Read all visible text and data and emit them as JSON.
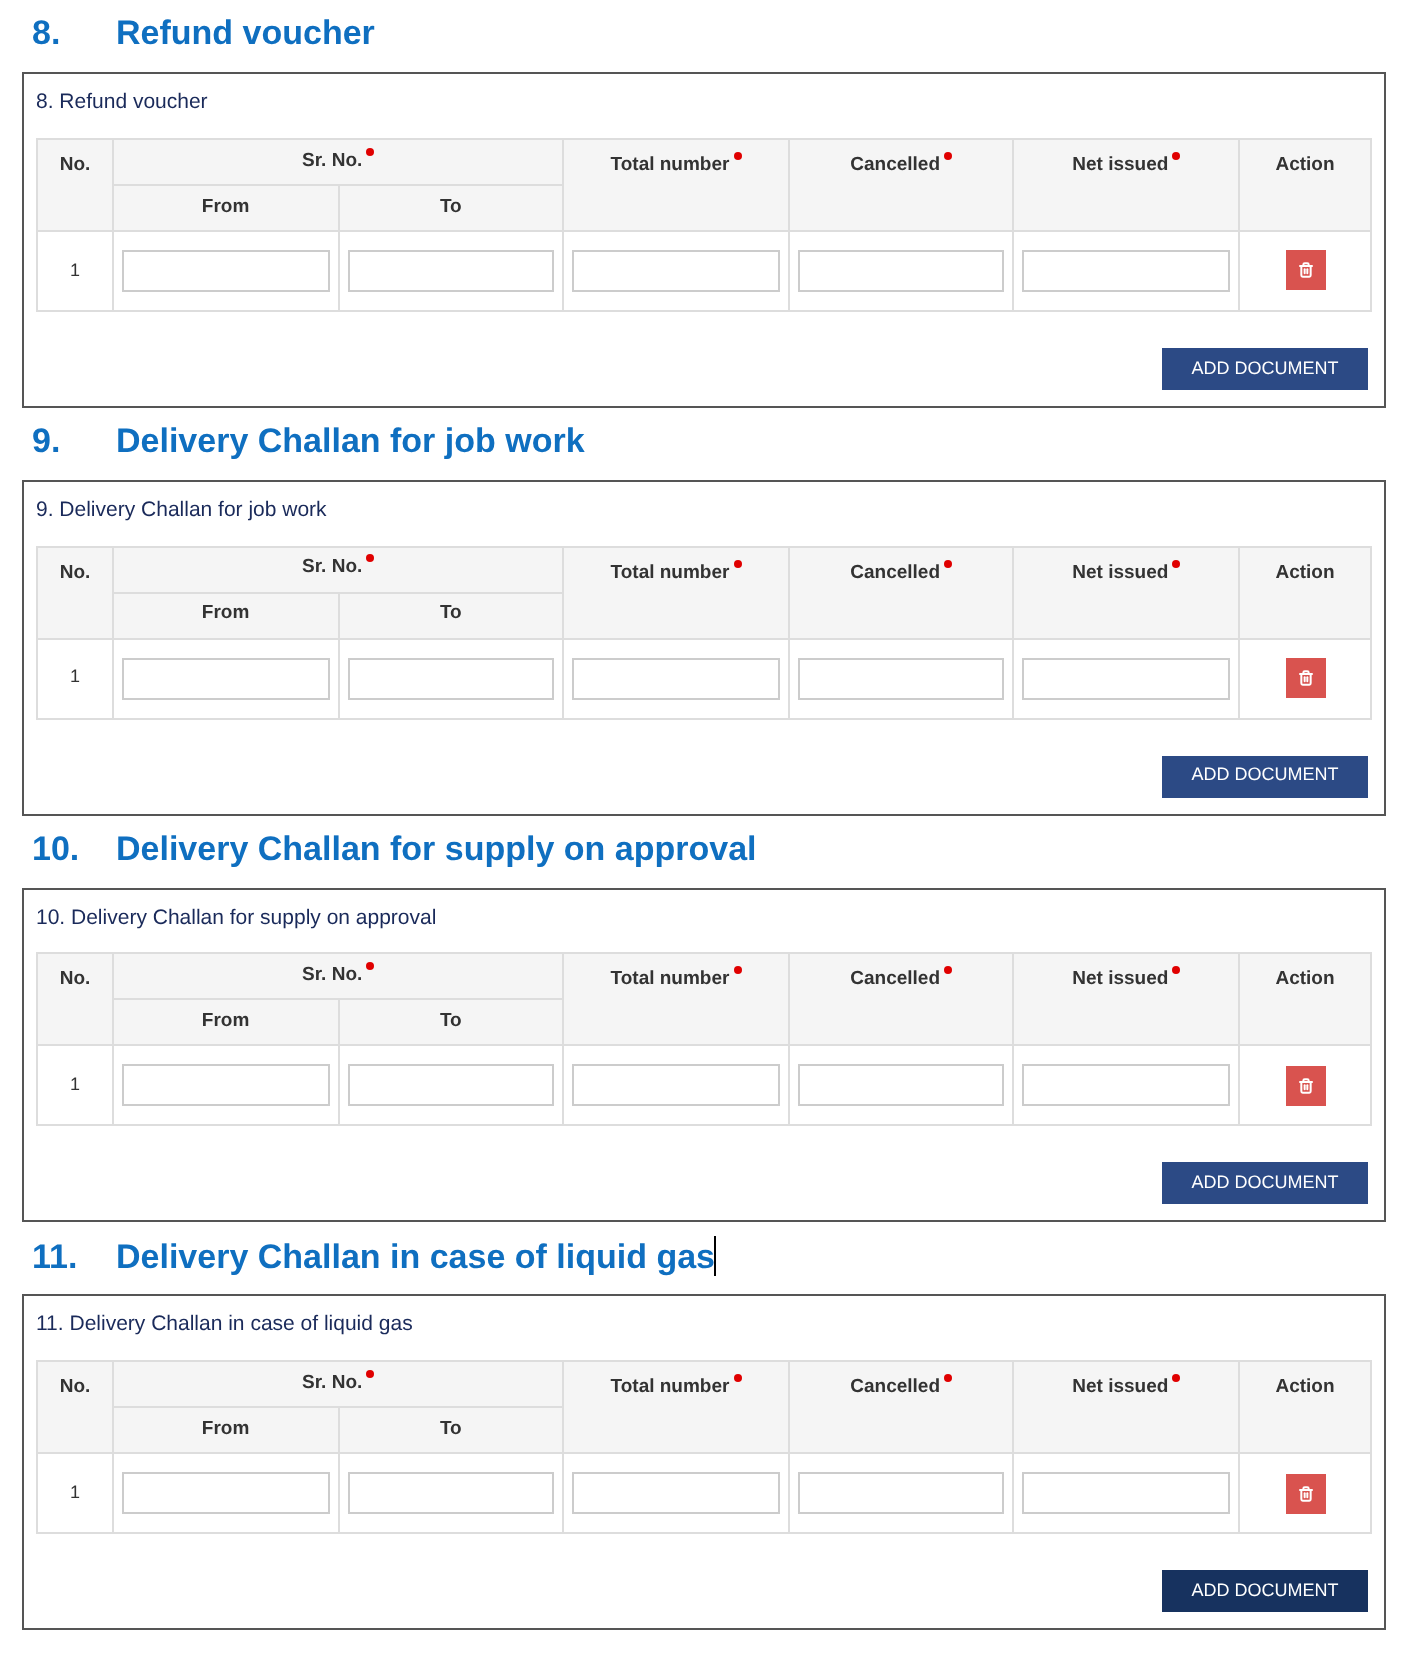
{
  "sections": [
    {
      "number": "8.",
      "heading": "Refund voucher",
      "form_title": "8. Refund voucher",
      "columns": {
        "no": "No.",
        "sr_no": "Sr. No.",
        "from": "From",
        "to": "To",
        "total": "Total number",
        "cancelled": "Cancelled",
        "net": "Net issued",
        "action": "Action"
      },
      "rows": [
        {
          "no": "1"
        }
      ],
      "button": {
        "label": "ADD DOCUMENT",
        "hovered": false
      },
      "text_cursor": false
    },
    {
      "number": "9.",
      "heading": "Delivery Challan for job work",
      "form_title": "9. Delivery Challan for job work",
      "columns": {
        "no": "No.",
        "sr_no": "Sr. No.",
        "from": "From",
        "to": "To",
        "total": "Total number",
        "cancelled": "Cancelled",
        "net": "Net issued",
        "action": "Action"
      },
      "rows": [
        {
          "no": "1"
        }
      ],
      "button": {
        "label": "ADD DOCUMENT",
        "hovered": false
      },
      "text_cursor": false
    },
    {
      "number": "10.",
      "heading": "Delivery Challan for supply on approval",
      "form_title": "10. Delivery Challan for supply on approval",
      "columns": {
        "no": "No.",
        "sr_no": "Sr. No.",
        "from": "From",
        "to": "To",
        "total": "Total number",
        "cancelled": "Cancelled",
        "net": "Net issued",
        "action": "Action"
      },
      "rows": [
        {
          "no": "1"
        }
      ],
      "button": {
        "label": "ADD DOCUMENT",
        "hovered": false
      },
      "text_cursor": false
    },
    {
      "number": "11.",
      "heading": "Delivery Challan in case of liquid gas",
      "form_title": "11. Delivery Challan in case of liquid gas",
      "columns": {
        "no": "No.",
        "sr_no": "Sr. No.",
        "from": "From",
        "to": "To",
        "total": "Total number",
        "cancelled": "Cancelled",
        "net": "Net issued",
        "action": "Action"
      },
      "rows": [
        {
          "no": "1"
        }
      ],
      "button": {
        "label": "ADD DOCUMENT",
        "hovered": true
      },
      "text_cursor": true
    }
  ]
}
